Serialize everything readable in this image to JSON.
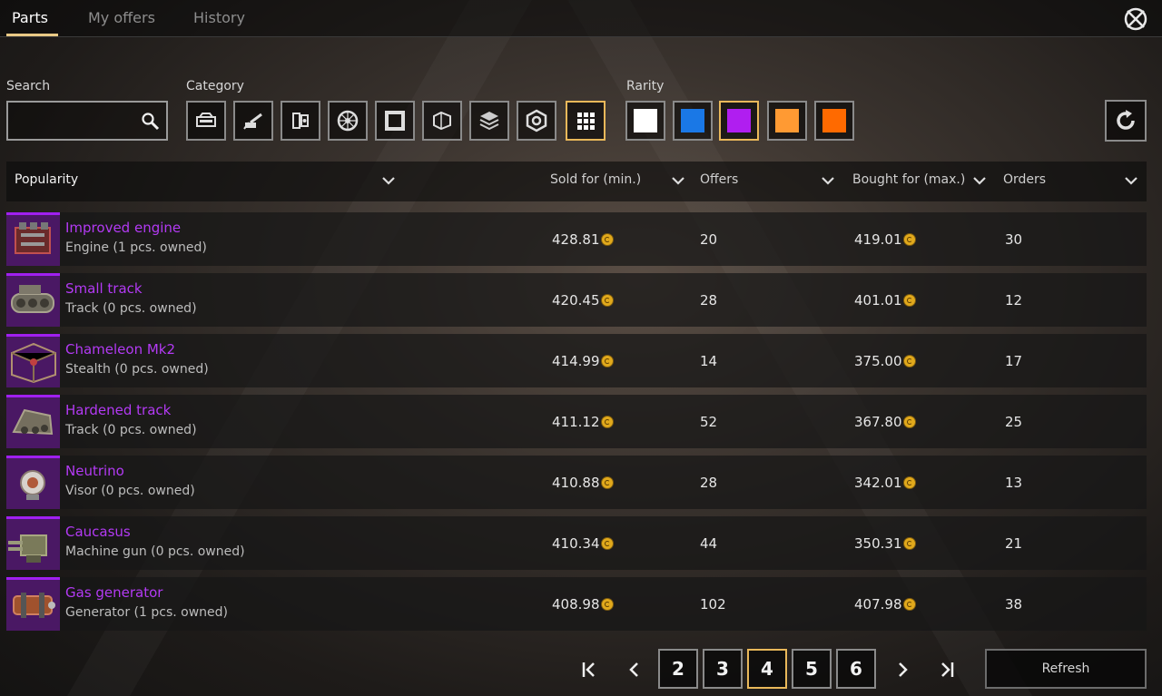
{
  "tabs": [
    {
      "label": "Parts",
      "active": true
    },
    {
      "label": "My offers",
      "active": false
    },
    {
      "label": "History",
      "active": false
    }
  ],
  "filters": {
    "search_label": "Search",
    "search_value": "",
    "category_label": "Category",
    "categories": [
      "cabin-icon",
      "weapon-icon",
      "module-icon",
      "wheel-icon",
      "frame-icon",
      "structure-icon",
      "resources-icon",
      "hexagon-icon",
      "all-icon"
    ],
    "selected_category": "all",
    "rarity_label": "Rarity",
    "rarities": [
      {
        "name": "Common",
        "color": "#ffffff"
      },
      {
        "name": "Rare",
        "color": "#1a78e6"
      },
      {
        "name": "Epic",
        "color": "#b01ef0"
      },
      {
        "name": "Special",
        "color": "#ff9a33"
      },
      {
        "name": "Legendary",
        "color": "#ff6a00"
      }
    ],
    "selected_rarity": "Epic"
  },
  "table": {
    "headers": {
      "sort": "Popularity",
      "sold": "Sold for (min.)",
      "offers": "Offers",
      "bought": "Bought for (max.)",
      "orders": "Orders"
    },
    "rows": [
      {
        "name": "Improved engine",
        "sub": "Engine (1 pcs. owned)",
        "sold": "428.81",
        "offers": "20",
        "bought": "419.01",
        "orders": "30",
        "icon": "engine-icon"
      },
      {
        "name": "Small track",
        "sub": "Track (0 pcs. owned)",
        "sold": "420.45",
        "offers": "28",
        "bought": "401.01",
        "orders": "12",
        "icon": "track-icon"
      },
      {
        "name": "Chameleon Mk2",
        "sub": "Stealth (0 pcs. owned)",
        "sold": "414.99",
        "offers": "14",
        "bought": "375.00",
        "orders": "17",
        "icon": "stealth-icon"
      },
      {
        "name": "Hardened track",
        "sub": "Track (0 pcs. owned)",
        "sold": "411.12",
        "offers": "52",
        "bought": "367.80",
        "orders": "25",
        "icon": "track-icon"
      },
      {
        "name": "Neutrino",
        "sub": "Visor (0 pcs. owned)",
        "sold": "410.88",
        "offers": "28",
        "bought": "342.01",
        "orders": "13",
        "icon": "visor-icon"
      },
      {
        "name": "Caucasus",
        "sub": "Machine gun (0 pcs. owned)",
        "sold": "410.34",
        "offers": "44",
        "bought": "350.31",
        "orders": "21",
        "icon": "machine-gun-icon"
      },
      {
        "name": "Gas generator",
        "sub": "Generator (1 pcs. owned)",
        "sold": "408.98",
        "offers": "102",
        "bought": "407.98",
        "orders": "38",
        "icon": "generator-icon"
      }
    ]
  },
  "pagination": {
    "pages": [
      "2",
      "3",
      "4",
      "5",
      "6"
    ],
    "current": "4",
    "refresh_label": "Refresh"
  }
}
